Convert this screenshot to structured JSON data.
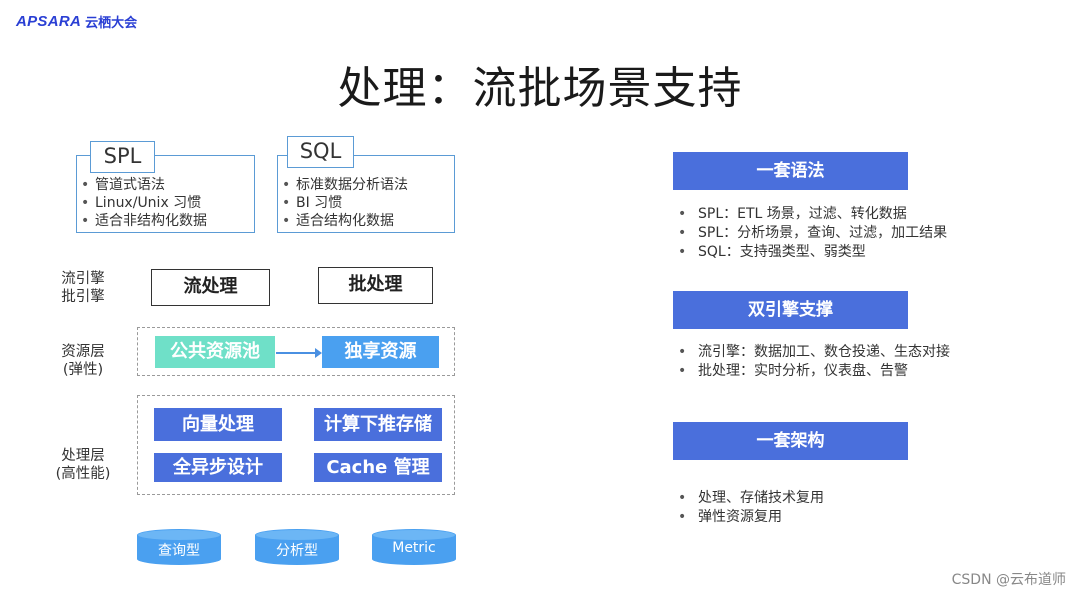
{
  "logo": {
    "brand": "APSARA",
    "cn": "云栖大会"
  },
  "title": "处理：流批场景支持",
  "languages": [
    {
      "name": "SPL",
      "items": [
        "管道式语法",
        "Linux/Unix 习惯",
        "适合非结构化数据"
      ]
    },
    {
      "name": "SQL",
      "items": [
        "标准数据分析语法",
        "BI 习惯",
        "适合结构化数据"
      ]
    }
  ],
  "engine_row": {
    "label_line1": "流引擎",
    "label_line2": "批引擎",
    "stream": "流处理",
    "batch": "批处理"
  },
  "resource_row": {
    "label_line1": "资源层",
    "label_line2": "(弹性)",
    "shared": "公共资源池",
    "dedicated": "独享资源"
  },
  "processing_row": {
    "label_line1": "处理层",
    "label_line2": "(高性能)",
    "items": [
      "向量处理",
      "计算下推存储",
      "全异步设计",
      "Cache 管理"
    ]
  },
  "storage": [
    "查询型",
    "分析型",
    "Metric"
  ],
  "sections": [
    {
      "header": "一套语法",
      "bullets": [
        "SPL：ETL 场景，过滤、转化数据",
        "SPL：分析场景，查询、过滤，加工结果",
        "SQL：支持强类型、弱类型"
      ]
    },
    {
      "header": "双引擎支撑",
      "bullets": [
        "流引擎：数据加工、数仓投递、生态对接",
        "批处理：实时分析，仪表盘、告警"
      ]
    },
    {
      "header": "一套架构",
      "bullets": [
        "处理、存储技术复用",
        "弹性资源复用"
      ]
    }
  ],
  "colors": {
    "primary_blue": "#4a6fdc",
    "teal": "#6fe0c8",
    "light_blue": "#4aa0f0",
    "box_border": "#5b9bd5"
  },
  "watermark": "CSDN @云布道师"
}
